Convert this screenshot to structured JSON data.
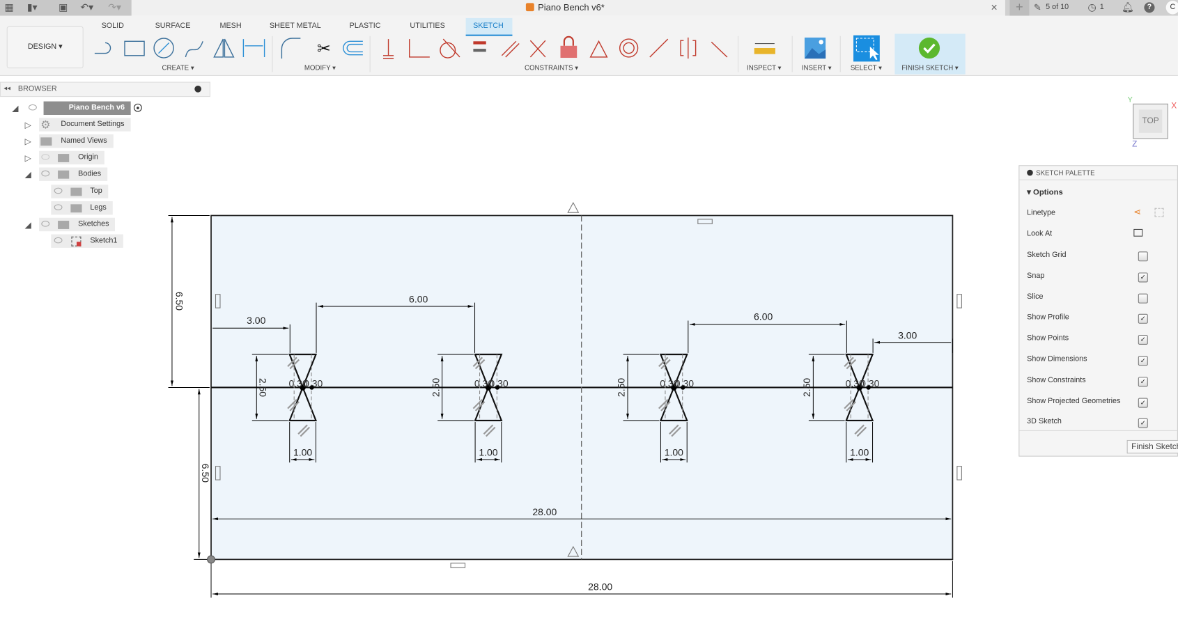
{
  "title_bar": {
    "document_title": "Piano Bench v6*",
    "job_status": "5 of 10",
    "clock_count": "1",
    "avatar_initial": "C"
  },
  "toolbar": {
    "workspace": "DESIGN ▾",
    "tabs": [
      "SOLID",
      "SURFACE",
      "MESH",
      "SHEET METAL",
      "PLASTIC",
      "UTILITIES",
      "SKETCH"
    ],
    "active_tab": "SKETCH",
    "groups": [
      "CREATE ▾",
      "MODIFY ▾",
      "CONSTRAINTS ▾",
      "INSPECT ▾",
      "INSERT ▾",
      "SELECT ▾",
      "FINISH SKETCH ▾"
    ]
  },
  "browser": {
    "title": "BROWSER",
    "items": [
      {
        "label": "Piano Bench v6"
      },
      {
        "label": "Document Settings"
      },
      {
        "label": "Named Views"
      },
      {
        "label": "Origin"
      },
      {
        "label": "Bodies"
      },
      {
        "label": "Top"
      },
      {
        "label": "Legs"
      },
      {
        "label": "Sketches"
      },
      {
        "label": "Sketch1"
      }
    ]
  },
  "viewcube": {
    "face": "TOP",
    "x": "X",
    "y": "Y",
    "z": "Z"
  },
  "sketch_palette": {
    "title": "SKETCH PALETTE",
    "section": "Options",
    "linetype": "Linetype",
    "look_at": "Look At",
    "options": [
      {
        "label": "Sketch Grid",
        "checked": false
      },
      {
        "label": "Snap",
        "checked": true
      },
      {
        "label": "Slice",
        "checked": false
      },
      {
        "label": "Show Profile",
        "checked": true
      },
      {
        "label": "Show Points",
        "checked": true
      },
      {
        "label": "Show Dimensions",
        "checked": true
      },
      {
        "label": "Show Constraints",
        "checked": true
      },
      {
        "label": "Show Projected Geometries",
        "checked": true
      },
      {
        "label": "3D Sketch",
        "checked": true
      }
    ],
    "finish_button": "Finish Sketch"
  },
  "sketch": {
    "dims": {
      "width_inner": "28.00",
      "width_outer": "28.00",
      "half_height_top": "6.50",
      "half_height_bottom": "6.50",
      "offset_left": "3.00",
      "offset_right": "3.00",
      "spacing_left": "6.00",
      "spacing_right": "6.00"
    },
    "legs": [
      {
        "height": "2.50",
        "width": "1.00",
        "inset_a": "0.30",
        "inset_b": "0.30"
      },
      {
        "height": "2.50",
        "width": "1.00",
        "inset_a": "0.30",
        "inset_b": "0.30"
      },
      {
        "height": "2.50",
        "width": "1.00",
        "inset_a": "0.30",
        "inset_b": "0.30"
      },
      {
        "height": "2.50",
        "width": "1.00",
        "inset_a": "0.30",
        "inset_b": "0.30"
      }
    ]
  },
  "colors": {
    "accent": "#2b8fd6",
    "sketch_fill": "#eef5fb",
    "constraint_red": "#c0392b",
    "finish_green": "#5cb82e"
  }
}
